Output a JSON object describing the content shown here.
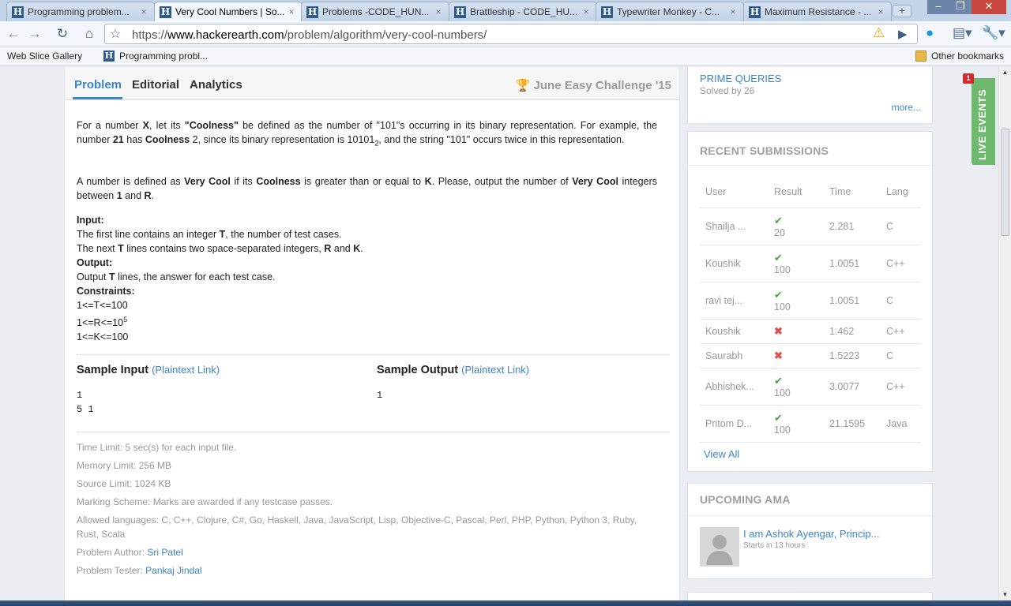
{
  "browser": {
    "tabs": [
      {
        "title": "Programming problem...",
        "active": false
      },
      {
        "title": "Very Cool Numbers | So...",
        "active": true
      },
      {
        "title": "Problems -CODE_HUN...",
        "active": false
      },
      {
        "title": "Brattleship - CODE_HU...",
        "active": false
      },
      {
        "title": "Typewriter Monkey - C...",
        "active": false
      },
      {
        "title": "Maximum Resistance - ...",
        "active": false
      }
    ],
    "close_glyph": "×",
    "new_tab_glyph": "+",
    "url_scheme": "https://",
    "url_host": "www.hackerearth.com",
    "url_path": "/problem/algorithm/very-cool-numbers/",
    "bookmarks": [
      {
        "label": "Web Slice Gallery"
      },
      {
        "label": "Programming probl..."
      }
    ],
    "other_bookmarks": "Other bookmarks"
  },
  "problem_tabs": {
    "problem": "Problem",
    "editorial": "Editorial",
    "analytics": "Analytics",
    "contest": "June Easy Challenge '15"
  },
  "statement": {
    "p1_a": "For a number ",
    "p1_x": "X",
    "p1_b": ", let its ",
    "p1_coolness_q": "\"Coolness\"",
    "p1_c": " be defined as the number of \"101\"s occurring in its binary representation. For example, the number ",
    "p1_21": "21",
    "p1_d": " has ",
    "p1_coolness": "Coolness",
    "p1_e": " 2, since its binary representation is 10101",
    "p1_sub": "2",
    "p1_f": ", and the string \"101\" occurs twice in this representation.",
    "p2_a": "A number is defined as ",
    "p2_vc": "Very Cool",
    "p2_b": " if its ",
    "p2_coolness": "Coolness",
    "p2_c": " is greater than or equal to ",
    "p2_k": "K",
    "p2_d": ". Please, output the number of ",
    "p2_vc2": "Very Cool",
    "p2_e": " integers between ",
    "p2_1": "1",
    "p2_f": " and ",
    "p2_r": "R",
    "p2_g": ".",
    "input_head": "Input",
    "in1_a": "The first line contains an integer ",
    "in1_t": "T",
    "in1_b": ", the number of test cases.",
    "in2_a": "The next ",
    "in2_t": "T",
    "in2_b": " lines contains two space-separated integers, ",
    "in2_r": "R",
    "in2_c": " and ",
    "in2_k": "K",
    "in2_d": ".",
    "output_head": "Output",
    "out_a": "Output ",
    "out_t": "T",
    "out_b": " lines, the answer for each test case.",
    "constraints_head": "Constraints",
    "c1": "1<=T<=100",
    "c2_a": "1<=R<=10",
    "c2_sup": "5",
    "c3": "1<=K<=100",
    "colon": ":"
  },
  "samples": {
    "input_title": "Sample Input",
    "output_title": "Sample Output",
    "plaintext_link": "(Plaintext Link)",
    "input_line1": "1",
    "input_line2": "5 1",
    "output_line1": "1"
  },
  "limits": {
    "time": "Time Limit: 5 sec(s) for each input file.",
    "memory": "Memory Limit: 256 MB",
    "source": "Source Limit: 1024 KB",
    "marking": "Marking Scheme: Marks are awarded if any testcase passes.",
    "languages": "Allowed languages: C, C++, Clojure, C#, Go, Haskell, Java, JavaScript, Lisp, Objective-C, Pascal, Perl, PHP, Python, Python 3, Ruby, Rust, Scala",
    "author_label": "Problem Author: ",
    "author": "Sri Patel",
    "tester_label": "Problem Tester: ",
    "tester": "Pankaj Jindal"
  },
  "sidebar": {
    "prime_title": "PRIME QUERIES",
    "prime_solved": "Solved by 26",
    "more": "more...",
    "recent_title": "RECENT SUBMISSIONS",
    "columns": [
      "User",
      "Result",
      "Time",
      "Lang"
    ],
    "submissions": [
      {
        "user": "Shailja ...",
        "status": "pass",
        "score": "20",
        "time": "2.281",
        "lang": "C"
      },
      {
        "user": "Koushik",
        "status": "pass",
        "score": "100",
        "time": "1.0051",
        "lang": "C++"
      },
      {
        "user": "ravi tej...",
        "status": "pass",
        "score": "100",
        "time": "1.0051",
        "lang": "C"
      },
      {
        "user": "Koushik",
        "status": "fail",
        "score": "",
        "time": "1.462",
        "lang": "C++"
      },
      {
        "user": "Saurabh",
        "status": "fail",
        "score": "",
        "time": "1.5223",
        "lang": "C"
      },
      {
        "user": "Abhishek...",
        "status": "pass",
        "score": "100",
        "time": "3.0077",
        "lang": "C++"
      },
      {
        "user": "Pritom D...",
        "status": "pass",
        "score": "100",
        "time": "21.1595",
        "lang": "Java"
      }
    ],
    "view_all": "View All",
    "ama_title": "UPCOMING AMA",
    "ama_headline": "I am Ashok Ayengar, Princip...",
    "ama_time": "Starts in 13 hours"
  },
  "live_events": {
    "label": "LIVE EVENTS",
    "badge": "1"
  },
  "icons": {
    "tab_favicon": "hackerearth-favicon-icon",
    "check": "✔",
    "cross": "✖"
  }
}
